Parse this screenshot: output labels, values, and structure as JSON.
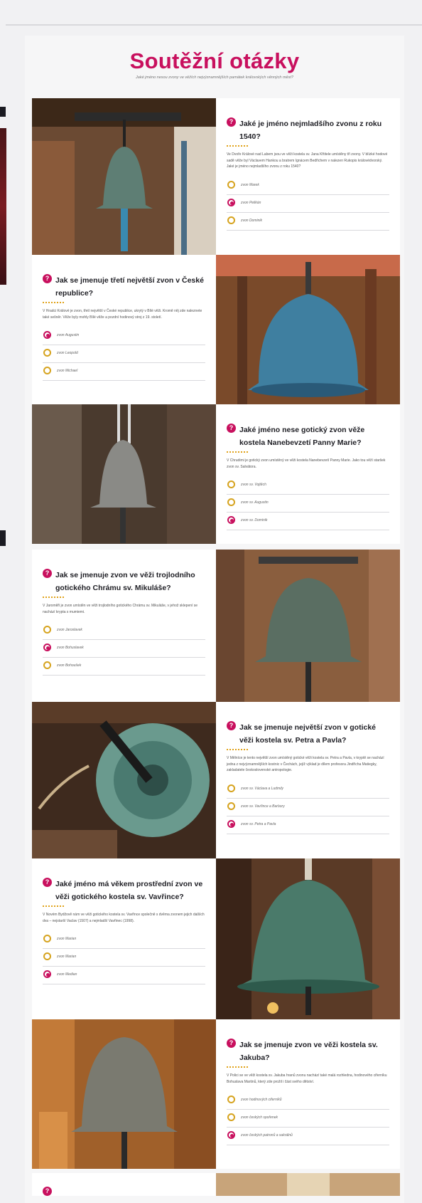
{
  "page": {
    "title": "Soutěžní otázky",
    "subtitle": "Jaké jméno nesou zvony ve věžích nejvýznamnějších památek královských věnných měst?"
  },
  "colors": {
    "accent": "#c8105e",
    "radio_ring": "#d6a31e",
    "background": "#f1f1f3"
  },
  "questions": [
    {
      "question": "Jaké je jméno nejmladšího zvonu z roku 1540?",
      "description": "Ve Dvoře Králové nad Labem jsou ve věži kostela sv. Jana Křtitele umístěny tři zvony. V blízké hodové sadě věže byl Václavem Hankou a bratrem Ignácem Bedřichem v nalezen Rukopis královédvorský. Jaké je jméno nejmladšího zvonu z roku 1540?",
      "options": [
        "zvon Marek",
        "zvon Pelikán",
        "zvon Dominik"
      ],
      "selected": 1
    },
    {
      "question": "Jak se jmenuje třetí největší zvon v České republice?",
      "description": "V Hradci Králové je zvon, třetí největší v České republice, ukrytý v Bílé věži. Kromě něj zde naleznete také sešněr. Věže byly mohly Bílé věže a pozdní hodinový stroj z 19. století.",
      "options": [
        "zvon Augustin",
        "zvon Leopold",
        "zvon Michael"
      ],
      "selected": 0
    },
    {
      "question": "Jaké jméno nese gotický zvon věže kostela Nanebevzetí Panny Marie?",
      "description": "V Chrudimi je gotický zvon umístěný ve věži kostela Nanebevzetí Panny Marie. Jako tou věží staršek zvon sv. Salvátora.",
      "options": [
        "zvon sv. Vojtěch",
        "zvon sv. Augustin",
        "zvon sv. Dominik"
      ],
      "selected": 2
    },
    {
      "question": "Jak se jmenuje zvon ve věži trojlodního gotického Chrámu sv. Mikuláše?",
      "description": "V Jaroměři je zvon umístěn ve věži trojlodního gotického Chrámu sv. Mikuláše, v jehož sklepení se nachází krypta s mumiemi.",
      "options": [
        "zvon Jaroslavek",
        "zvon Bohuslavek",
        "zvon Bohoušek"
      ],
      "selected": 1
    },
    {
      "question": "Jak se jmenuje největší zvon v gotické věži kostela sv. Petra a Pavla?",
      "description": "V Mělníce je tento největší zvon umístěný gotické věži kostela sv. Petra a Pavla, v kryptě se nachází jedna z nejvýznamnějších kostnic v Čechách, jejíž výklad je dílem profesora Jindřicha Matiegky, zakladatele československé antropologie.",
      "options": [
        "zvon sv. Václava a Ludmily",
        "zvon sv. Vavřince a Barbory",
        "zvon sv. Petra a Pavla"
      ],
      "selected": 2
    },
    {
      "question": "Jaké jméno má věkem prostřední zvon ve věži gotického kostela sv. Vavřince?",
      "description": "V Novém Bydžově nám ve věži gotického kostela sv. Vavřince společně s dvěma zvonem jejich dalších dva – nejstarší Vaclav (1507) a nejmladší Vavřinec (1998).",
      "options": [
        "zvon Marian",
        "zvon Marian",
        "zvon Median"
      ],
      "selected": 2
    },
    {
      "question": "Jak se jmenuje zvon ve věži kostela sv. Jakuba?",
      "description": "V Polici se ve věži kostela sv. Jakuba hranů zvonu nachází také malá rozhledna, hodinového ciferníku Bohuslava Martinů, který zde prožil i část svého dětství.",
      "options": [
        "zvon hodinových ciferníků",
        "zvon českých spořenek",
        "zvon českých patronů a sakrálnů"
      ],
      "selected": 2
    }
  ]
}
